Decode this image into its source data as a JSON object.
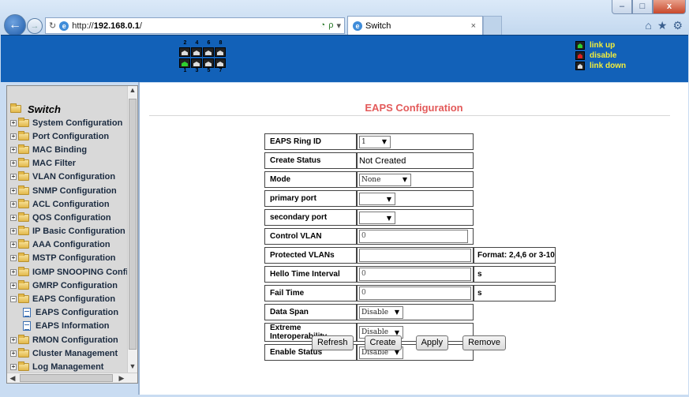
{
  "browser": {
    "url_prefix": "http://",
    "url_host": "192.168.0.1",
    "url_suffix": "/",
    "tab_title": "Switch",
    "tab_close": "×",
    "window_min": "–",
    "window_max": "□",
    "window_close": "x",
    "back_glyph": "←",
    "forward_glyph": "→",
    "search_glyph": "ρ",
    "tool_icons": [
      "home-icon",
      "star-icon",
      "gear-icon"
    ]
  },
  "banner": {
    "port_numbers_top": [
      "2",
      "4",
      "6",
      "8"
    ],
    "port_numbers_bottom": [
      "1",
      "3",
      "5",
      "7"
    ],
    "ports_top": [
      "down",
      "down",
      "down",
      "down"
    ],
    "ports_bottom": [
      "up",
      "down",
      "down",
      "down"
    ],
    "legend": [
      {
        "label": "link up",
        "color": "#2fd02f"
      },
      {
        "label": "disable",
        "color": "#e02020"
      },
      {
        "label": "link down",
        "color": "#dddddd"
      }
    ],
    "background": "#1261b8",
    "legend_text_color": "#f4ee3a"
  },
  "sidebar": {
    "root": "Switch",
    "items": [
      {
        "label": "System Configuration",
        "type": "folder"
      },
      {
        "label": "Port Configuration",
        "type": "folder"
      },
      {
        "label": "MAC Binding",
        "type": "folder"
      },
      {
        "label": "MAC Filter",
        "type": "folder"
      },
      {
        "label": "VLAN Configuration",
        "type": "folder"
      },
      {
        "label": "SNMP Configuration",
        "type": "folder"
      },
      {
        "label": "ACL Configuration",
        "type": "folder"
      },
      {
        "label": "QOS Configuration",
        "type": "folder"
      },
      {
        "label": "IP Basic Configuration",
        "type": "folder"
      },
      {
        "label": "AAA Configuration",
        "type": "folder"
      },
      {
        "label": "MSTP Configuration",
        "type": "folder"
      },
      {
        "label": "IGMP SNOOPING Confi",
        "type": "folder"
      },
      {
        "label": "GMRP Configuration",
        "type": "folder"
      },
      {
        "label": "EAPS Configuration",
        "type": "open-folder"
      },
      {
        "label": "EAPS Configuration",
        "type": "leaf"
      },
      {
        "label": "EAPS Information",
        "type": "leaf"
      },
      {
        "label": "RMON Configuration",
        "type": "folder"
      },
      {
        "label": "Cluster Management",
        "type": "folder"
      },
      {
        "label": "Log Management",
        "type": "folder"
      }
    ]
  },
  "main": {
    "title": "EAPS Configuration",
    "title_color": "#e35a5a",
    "rows": {
      "ring_id": {
        "label": "EAPS Ring ID",
        "value": "1"
      },
      "create_status": {
        "label": "Create Status",
        "value": "Not Created"
      },
      "mode": {
        "label": "Mode",
        "value": "None"
      },
      "primary_port": {
        "label": "primary port",
        "value": ""
      },
      "secondary_port": {
        "label": "secondary port",
        "value": ""
      },
      "control_vlan": {
        "label": "Control VLAN",
        "value": "0"
      },
      "protected_vlans": {
        "label": "Protected VLANs",
        "value": "",
        "note": "Format: 2,4,6 or 3-10"
      },
      "hello_time": {
        "label": "Hello Time Interval",
        "value": "0",
        "note": "s"
      },
      "fail_time": {
        "label": "Fail Time",
        "value": "0",
        "note": "s"
      },
      "data_span": {
        "label": "Data Span",
        "value": "Disable"
      },
      "extreme_interop": {
        "label": "Extreme Interoperability",
        "value": "Disable"
      },
      "enable_status": {
        "label": "Enable Status",
        "value": "Disable"
      }
    },
    "buttons": {
      "refresh": "Refresh",
      "create": "Create",
      "apply": "Apply",
      "remove": "Remove"
    }
  }
}
